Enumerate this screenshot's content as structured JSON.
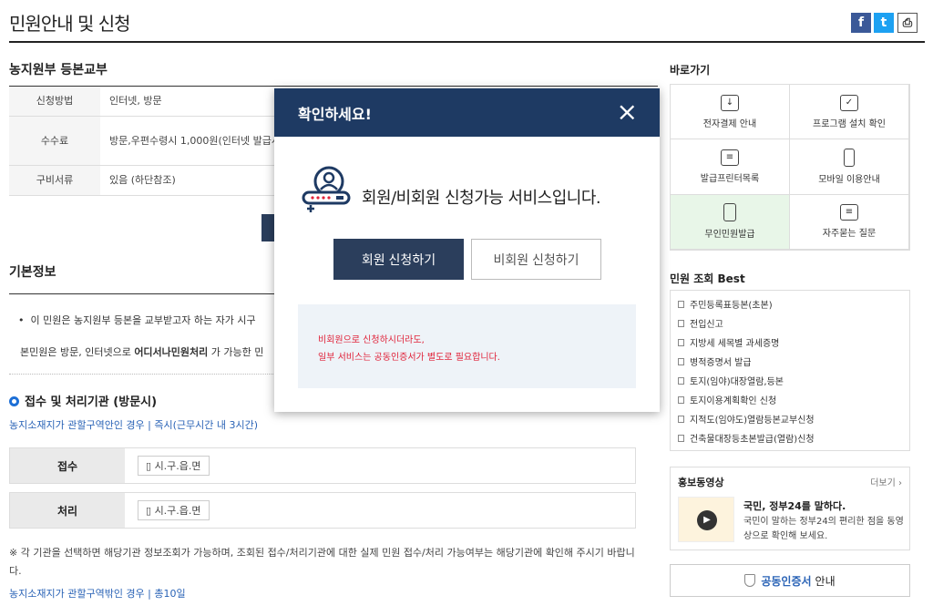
{
  "page": {
    "title": "민원안내 및 신청"
  },
  "share": {
    "facebook": "f",
    "twitter": "t",
    "print": "⎙"
  },
  "service": {
    "title": "농지원부 등본교부",
    "rows": [
      {
        "label": "신청방법",
        "value": "인터넷, 방문"
      },
      {
        "label": "수수료",
        "value": "방문,우편수령시 1,000원(인터넷 발급시"
      },
      {
        "label": "구비서류",
        "value": "있음 (하단참조)"
      }
    ]
  },
  "basic": {
    "title": "기본정보",
    "bullet": "이 민원은 농지원부 등본을 교부받고자 하는 자가 시구",
    "text_pre": "본민원은 방문, 인터넷으로 ",
    "text_bold": "어디서나민원처리",
    "text_post": " 가 가능한 민"
  },
  "process": {
    "title": "접수 및 처리기관 (방문시)",
    "link1": "농지소재지가 관할구역안인 경우 | 즉시(근무시간 내 3시간)",
    "rows": [
      {
        "label": "접수",
        "chip": "시.구.읍.면"
      },
      {
        "label": "처리",
        "chip": "시.구.읍.면"
      }
    ],
    "note": "※ 각 기관을 선택하면 해당기관 정보조회가 가능하며, 조회된 접수/처리기관에 대한 실제 민원 접수/처리 가능여부는 해당기관에 확인해 주시기 바랍니다.",
    "link2": "농지소재지가 관할구역밖인 경우 | 총10일"
  },
  "sidebar": {
    "shortcut_title": "바로가기",
    "shortcuts": [
      {
        "label": "전자결제 안내",
        "icon": "download-icon"
      },
      {
        "label": "프로그램 설치 확인",
        "icon": "monitor-icon"
      },
      {
        "label": "발급프린터목록",
        "icon": "printer-icon"
      },
      {
        "label": "모바일 이용안내",
        "icon": "mobile-icon"
      },
      {
        "label": "무인민원발급",
        "icon": "kiosk-icon"
      },
      {
        "label": "자주묻는 질문",
        "icon": "chat-icon"
      }
    ],
    "best_title": "민원 조회 Best",
    "best": [
      "주민등록표등본(초본)",
      "전입신고",
      "지방세 세목별 과세증명",
      "병적증명서 발급",
      "토지(임야)대장열람,등본",
      "토지이용계획확인 신청",
      "지적도(임야도)열람등본교부신청",
      "건축물대장등초본발급(열람)신청"
    ],
    "promo_title": "홍보동영상",
    "promo_more": "더보기",
    "promo_video_title": "국민, 정부24를 말하다.",
    "promo_video_desc": "국민이 말하는 정부24의 편리한 점을 동영상으로 확인해 보세요.",
    "cert_bold": "공동인증서",
    "cert_rest": "안내"
  },
  "modal": {
    "title": "확인하세요!",
    "close": "×",
    "message": "회원/비회원 신청가능 서비스입니다.",
    "member_button": "회원 신청하기",
    "guest_button": "비회원 신청하기",
    "note_line1": "비회원으로 신청하시더라도,",
    "note_line2": "일부 서비스는 공동인증서가 별도로 필요합니다."
  },
  "colors": {
    "navy": "#1e3a63",
    "button": "#2b3e5c",
    "alert": "#e0233a",
    "link": "#2a63b6"
  }
}
